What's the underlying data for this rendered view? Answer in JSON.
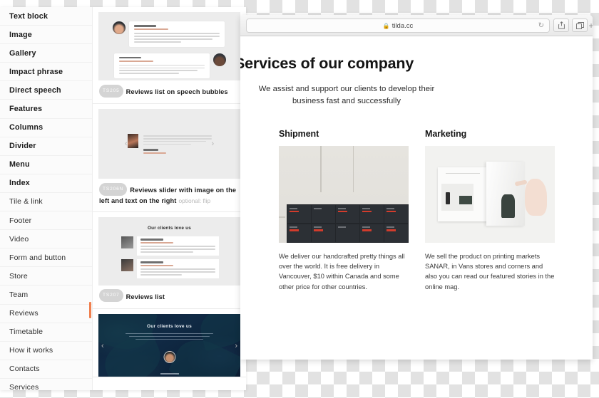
{
  "editor": {
    "categories": [
      {
        "label": "Text block",
        "strong": true,
        "active": false
      },
      {
        "label": "Image",
        "strong": true,
        "active": false
      },
      {
        "label": "Gallery",
        "strong": true,
        "active": false
      },
      {
        "label": "Impact phrase",
        "strong": true,
        "active": false
      },
      {
        "label": "Direct speech",
        "strong": true,
        "active": false
      },
      {
        "label": "Features",
        "strong": true,
        "active": false
      },
      {
        "label": "Columns",
        "strong": true,
        "active": false
      },
      {
        "label": "Divider",
        "strong": true,
        "active": false
      },
      {
        "label": "Menu",
        "strong": true,
        "active": false
      },
      {
        "label": "Index",
        "strong": true,
        "active": false
      },
      {
        "label": "Tile & link",
        "strong": false,
        "active": false
      },
      {
        "label": "Footer",
        "strong": false,
        "active": false
      },
      {
        "label": "Video",
        "strong": false,
        "active": false
      },
      {
        "label": "Form and button",
        "strong": false,
        "active": false
      },
      {
        "label": "Store",
        "strong": false,
        "active": false
      },
      {
        "label": "Team",
        "strong": false,
        "active": false
      },
      {
        "label": "Reviews",
        "strong": false,
        "active": true
      },
      {
        "label": "Timetable",
        "strong": false,
        "active": false
      },
      {
        "label": "How it works",
        "strong": false,
        "active": false
      },
      {
        "label": "Contacts",
        "strong": false,
        "active": false
      },
      {
        "label": "Services",
        "strong": false,
        "active": false
      }
    ],
    "blocks": [
      {
        "badge": "TS205",
        "title": "Reviews list on speech bubbles",
        "sub": ""
      },
      {
        "badge": "TS206N",
        "title": "Reviews slider with image on the left and text on the right",
        "sub": "optional: flip"
      },
      {
        "badge": "TS207",
        "title": "Reviews list",
        "sub": "",
        "preview_heading": "Our clients love us"
      },
      {
        "badge": "",
        "title": "",
        "sub": "",
        "preview_heading": "Our clients love us"
      }
    ],
    "accent_color": "#F0804F"
  },
  "browser": {
    "url": "tilda.cc",
    "lock_icon": "🔒",
    "reload_icon": "↻",
    "share_icon": "↑",
    "tabs_icon": "❐",
    "newtab_icon": "+",
    "prev_arrow": "‹",
    "next_arrow": "›"
  },
  "page": {
    "title": "Services of our company",
    "subtitle": "We assist and support our clients to develop their business fast and successfully",
    "columns": [
      {
        "title": "Shipment",
        "text": "We deliver our handcrafted pretty things all over the world. It is free delivery in Vancouver, $10 within Canada and some other price for other countries."
      },
      {
        "title": "Marketing",
        "text": "We sell the product on printing markets SANAR, in Vans stores and corners and also you can read our featured stories in the online mag."
      }
    ]
  }
}
